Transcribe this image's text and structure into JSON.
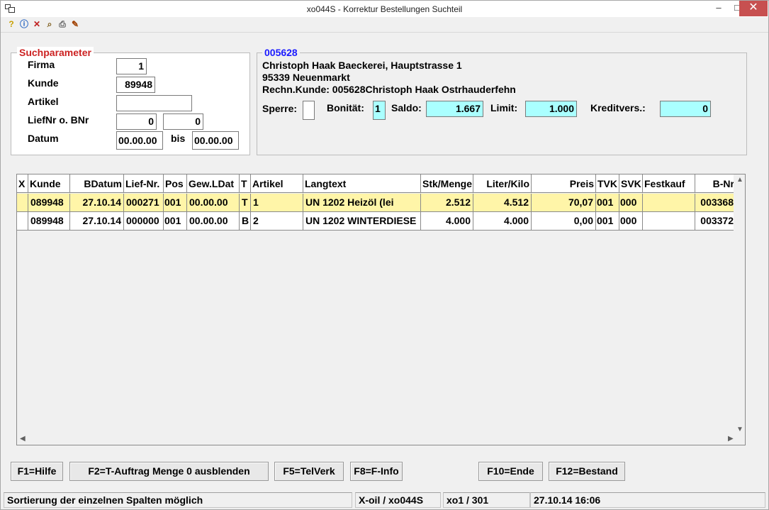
{
  "window": {
    "title": "xo044S - Korrektur Bestellungen Suchteil",
    "minimize": "–",
    "maximize": "□",
    "close": "✕"
  },
  "toolbar": {
    "icons": [
      "help-icon",
      "info-icon",
      "delete-icon",
      "search-icon",
      "print-icon",
      "settings-icon"
    ]
  },
  "search": {
    "legend": "Suchparameter",
    "firma_label": "Firma",
    "firma_value": "1",
    "kunde_label": "Kunde",
    "kunde_value": "89948",
    "artikel_label": "Artikel",
    "artikel_value": "",
    "liefnr_label": "LiefNr o. BNr",
    "liefnr_value": "0",
    "bnr_value": "0",
    "datum_label": "Datum",
    "datum_from": "00.00.00",
    "bis_label": "bis",
    "datum_to": "00.00.00"
  },
  "customer": {
    "legend": "005628",
    "name_line": "Christoph Haak Baeckerei, Hauptstrasse 1",
    "city_line": "95339 Neuenmarkt",
    "rechn_line": "Rechn.Kunde:  005628Christoph Haak Ostrhauderfehn",
    "sperre_label": "Sperre:",
    "sperre_value": "",
    "bonitaet_label": "Bonität:",
    "bonitaet_value": "1",
    "saldo_label": "Saldo:",
    "saldo_value": "1.667",
    "limit_label": "Limit:",
    "limit_value": "1.000",
    "kreditvers_label": "Kreditvers.:",
    "kreditvers_value": "0"
  },
  "table": {
    "headers": [
      "X",
      "Kunde",
      "BDatum",
      "Lief-Nr.",
      "Pos",
      "Gew.LDat",
      "T",
      "Artikel",
      "Langtext",
      "Stk/Menge",
      "Liter/Kilo",
      "Preis",
      "TVK",
      "SVK",
      "Festkauf",
      "B-Nr"
    ],
    "rows": [
      [
        "",
        "089948",
        "27.10.14",
        "000271",
        "001",
        "00.00.00",
        "T",
        "1",
        "UN 1202 Heizöl (lei",
        "2.512",
        "4.512",
        "70,07",
        "001",
        "000",
        "",
        "003368"
      ],
      [
        "",
        "089948",
        "27.10.14",
        "000000",
        "001",
        "00.00.00",
        "B",
        "2",
        "UN 1202 WINTERDIESE",
        "4.000",
        "4.000",
        "0,00",
        "001",
        "000",
        "",
        "003372"
      ]
    ],
    "selected_row_color": "#fff5a8"
  },
  "buttons": {
    "f1": "F1=Hilfe",
    "f2": "F2=T-Auftrag Menge 0 ausblenden",
    "f5": "F5=TelVerk",
    "f8": "F8=F-Info",
    "f10": "F10=Ende",
    "f12": "F12=Bestand"
  },
  "status": {
    "message": "Sortierung der einzelnen Spalten möglich",
    "program": "X-oil / xo044S",
    "user": "xo1 / 301",
    "datetime": "27.10.14 16:06"
  },
  "colors": {
    "legend_red": "#cc2222",
    "legend_blue": "#1a1aff",
    "cyan_field": "#aaffff"
  }
}
